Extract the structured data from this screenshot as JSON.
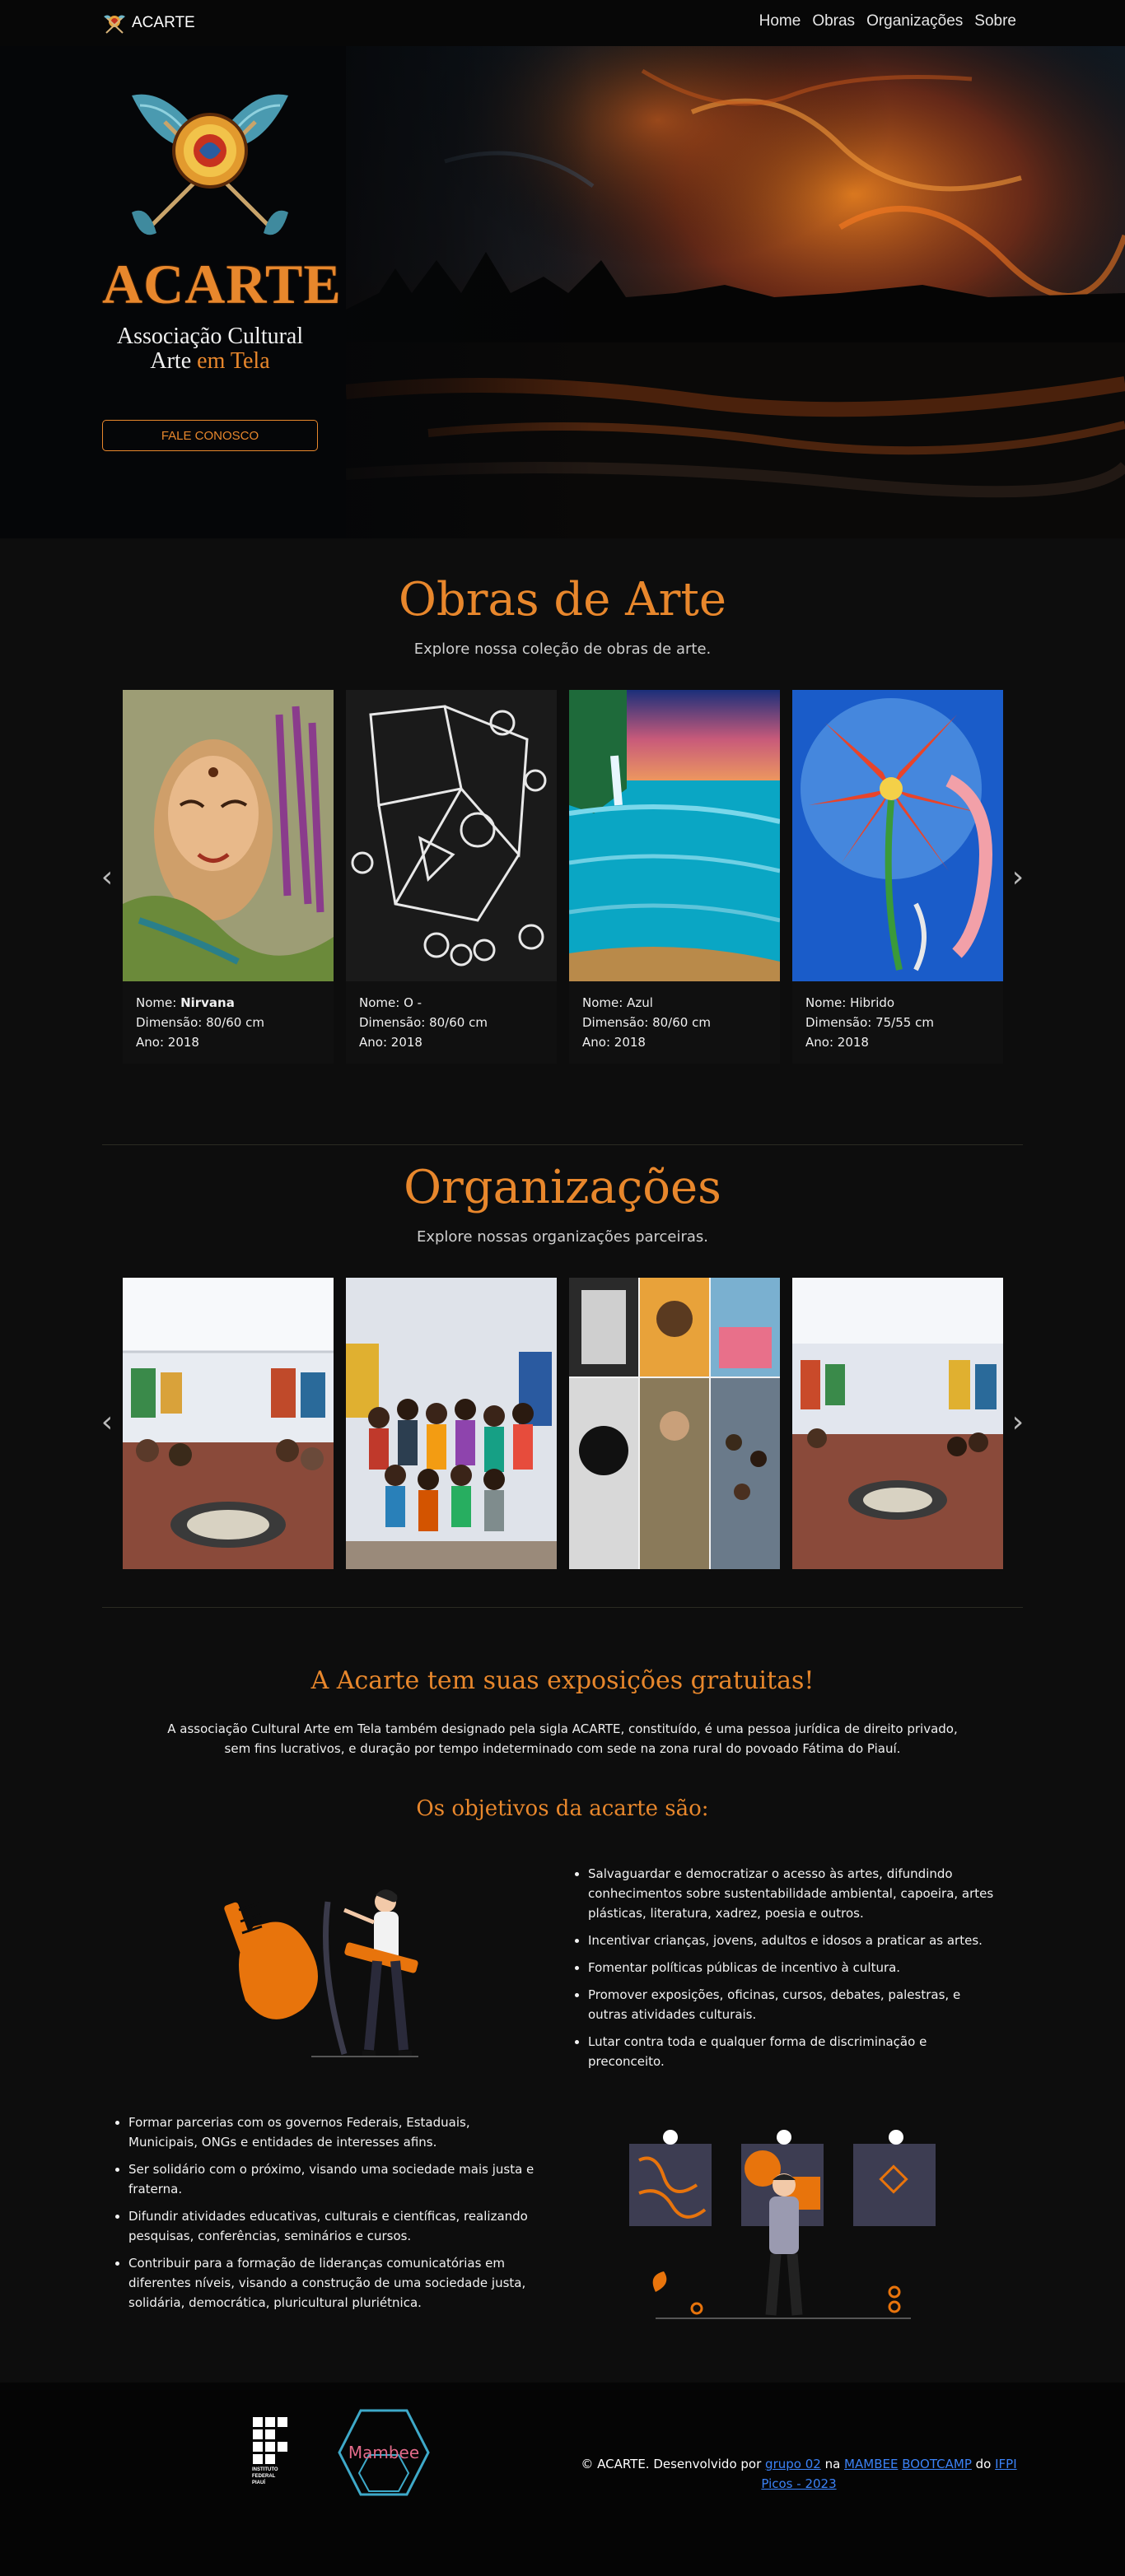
{
  "navbar": {
    "brand": "ACARTE",
    "links": [
      "Home",
      "Obras",
      "Organizações",
      "Sobre"
    ]
  },
  "hero": {
    "title": "ACARTE",
    "subtitle_line1": "Associação Cultural",
    "subtitle_line2_a": "Arte",
    "subtitle_line2_b": "em Tela",
    "cta": "FALE CONOSCO"
  },
  "obras": {
    "title": "Obras de Arte",
    "subtitle": "Explore nossa coleção de obras de arte.",
    "name_label": "Nome: ",
    "dim_label": "Dimensão: ",
    "year_label": "Ano: ",
    "items": [
      {
        "name": "Nirvana",
        "dim": "80/60 cm",
        "year": "2018"
      },
      {
        "name": "O -",
        "dim": "80/60 cm",
        "year": "2018"
      },
      {
        "name": "Azul",
        "dim": "80/60 cm",
        "year": "2018"
      },
      {
        "name": "Hibrido",
        "dim": "75/55 cm",
        "year": "2018"
      }
    ]
  },
  "orgs": {
    "title": "Organizações",
    "subtitle": "Explore nossas organizações parceiras."
  },
  "about": {
    "title": "A Acarte tem suas exposições gratuitas!",
    "text_line1": "A associação Cultural Arte em Tela também designado pela sigla ACARTE, constituído, é uma pessoa jurídica de direito privado,",
    "text_line2": "sem fins lucrativos, e duração por tempo indeterminado com sede na zona rural do povoado Fátima do Piauí.",
    "goals_title": "Os objetivos da acarte são:",
    "goals_right": [
      "Salvaguardar e democratizar o acesso às artes, difundindo conhecimentos sobre sustentabilidade ambiental, capoeira, artes plásticas, literatura, xadrez, poesia e outros.",
      "Incentivar crianças, jovens, adultos e idosos a praticar as artes.",
      "Fomentar políticas públicas de incentivo à cultura.",
      "Promover exposições, oficinas, cursos, debates, palestras, e outras atividades culturais.",
      "Lutar contra toda e qualquer forma de discriminação e preconceito."
    ],
    "goals_left": [
      "Formar parcerias com os governos Federais, Estaduais, Municipais, ONGs e entidades de interesses afins.",
      "Ser solidário com o próximo, visando uma sociedade mais justa e fraterna.",
      "Difundir atividades educativas, culturais e científicas, realizando pesquisas, conferências, seminários e cursos.",
      "Contribuir para a formação de lideranças comunicatórias em diferentes níveis, visando a construção de uma sociedade justa, solidária, democrática, pluricultural pluriétnica."
    ]
  },
  "footer": {
    "ifpi_lines": [
      "INSTITUTO",
      "FEDERAL",
      "PIAUÍ"
    ],
    "mambee_label": "Mambee",
    "text_a": "© ACARTE. Desenvolvido por ",
    "link_grupo": "grupo 02",
    "text_b": " na ",
    "link_mambee": "MAMBEE",
    "link_bootcamp": "BOOTCAMP",
    "text_c": " do ",
    "link_ifpi": "IFPI",
    "link_picos": "Picos - 2023"
  },
  "colors": {
    "accent": "#e8872c",
    "background": "#0d0d0d",
    "link": "#3b82f6"
  }
}
